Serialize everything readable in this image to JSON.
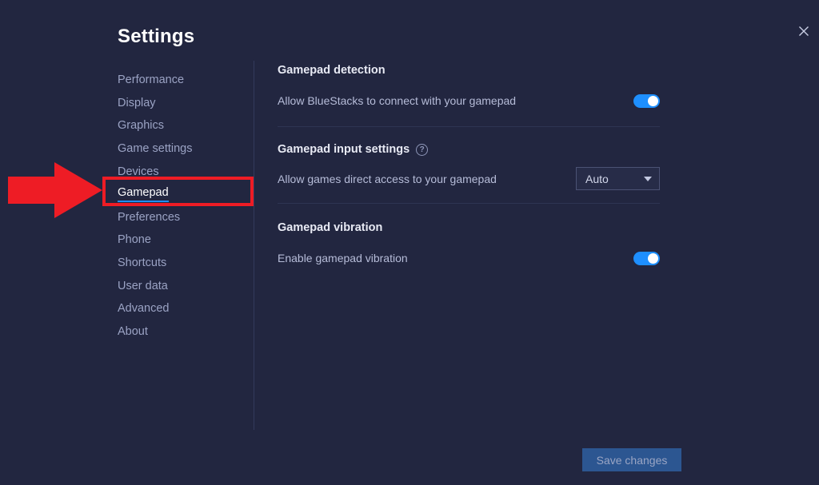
{
  "window": {
    "title": "Settings",
    "close_icon": "close-icon"
  },
  "sidebar": {
    "items": [
      {
        "label": "Performance",
        "active": false
      },
      {
        "label": "Display",
        "active": false
      },
      {
        "label": "Graphics",
        "active": false
      },
      {
        "label": "Game settings",
        "active": false
      },
      {
        "label": "Devices",
        "active": false
      },
      {
        "label": "Gamepad",
        "active": true
      },
      {
        "label": "Preferences",
        "active": false
      },
      {
        "label": "Phone",
        "active": false
      },
      {
        "label": "Shortcuts",
        "active": false
      },
      {
        "label": "User data",
        "active": false
      },
      {
        "label": "Advanced",
        "active": false
      },
      {
        "label": "About",
        "active": false
      }
    ]
  },
  "content": {
    "sections": [
      {
        "title": "Gamepad detection",
        "row_label": "Allow BlueStacks to connect with your gamepad",
        "control": "toggle",
        "toggle_state": "on"
      },
      {
        "title": "Gamepad input settings",
        "help_icon": "help-circle-icon",
        "row_label": "Allow games direct access to your gamepad",
        "control": "select",
        "select_value": "Auto",
        "select_options": [
          "Auto"
        ]
      },
      {
        "title": "Gamepad vibration",
        "row_label": "Enable gamepad vibration",
        "control": "toggle",
        "toggle_state": "on"
      }
    ]
  },
  "footer": {
    "save_label": "Save changes",
    "save_enabled": false
  },
  "annotations": {
    "arrow": "red-arrow-annotation",
    "highlight_rect": "red-highlight-rectangle",
    "target": "Gamepad"
  },
  "colors": {
    "background": "#222640",
    "accent_blue": "#1e8fff",
    "annotation_red": "#ee1c25",
    "save_button": "#2c5691"
  }
}
